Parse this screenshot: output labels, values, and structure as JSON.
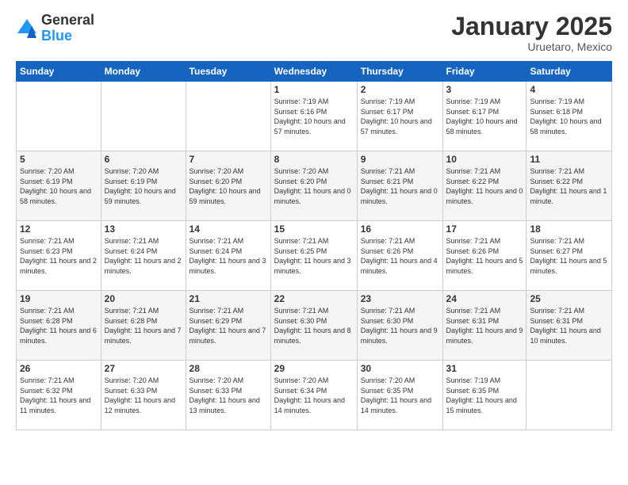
{
  "logo": {
    "general": "General",
    "blue": "Blue"
  },
  "header": {
    "month": "January 2025",
    "location": "Uruetaro, Mexico"
  },
  "weekdays": [
    "Sunday",
    "Monday",
    "Tuesday",
    "Wednesday",
    "Thursday",
    "Friday",
    "Saturday"
  ],
  "weeks": [
    [
      {
        "day": "",
        "info": ""
      },
      {
        "day": "",
        "info": ""
      },
      {
        "day": "",
        "info": ""
      },
      {
        "day": "1",
        "info": "Sunrise: 7:19 AM\nSunset: 6:16 PM\nDaylight: 10 hours and 57 minutes."
      },
      {
        "day": "2",
        "info": "Sunrise: 7:19 AM\nSunset: 6:17 PM\nDaylight: 10 hours and 57 minutes."
      },
      {
        "day": "3",
        "info": "Sunrise: 7:19 AM\nSunset: 6:17 PM\nDaylight: 10 hours and 58 minutes."
      },
      {
        "day": "4",
        "info": "Sunrise: 7:19 AM\nSunset: 6:18 PM\nDaylight: 10 hours and 58 minutes."
      }
    ],
    [
      {
        "day": "5",
        "info": "Sunrise: 7:20 AM\nSunset: 6:19 PM\nDaylight: 10 hours and 58 minutes."
      },
      {
        "day": "6",
        "info": "Sunrise: 7:20 AM\nSunset: 6:19 PM\nDaylight: 10 hours and 59 minutes."
      },
      {
        "day": "7",
        "info": "Sunrise: 7:20 AM\nSunset: 6:20 PM\nDaylight: 10 hours and 59 minutes."
      },
      {
        "day": "8",
        "info": "Sunrise: 7:20 AM\nSunset: 6:20 PM\nDaylight: 11 hours and 0 minutes."
      },
      {
        "day": "9",
        "info": "Sunrise: 7:21 AM\nSunset: 6:21 PM\nDaylight: 11 hours and 0 minutes."
      },
      {
        "day": "10",
        "info": "Sunrise: 7:21 AM\nSunset: 6:22 PM\nDaylight: 11 hours and 0 minutes."
      },
      {
        "day": "11",
        "info": "Sunrise: 7:21 AM\nSunset: 6:22 PM\nDaylight: 11 hours and 1 minute."
      }
    ],
    [
      {
        "day": "12",
        "info": "Sunrise: 7:21 AM\nSunset: 6:23 PM\nDaylight: 11 hours and 2 minutes."
      },
      {
        "day": "13",
        "info": "Sunrise: 7:21 AM\nSunset: 6:24 PM\nDaylight: 11 hours and 2 minutes."
      },
      {
        "day": "14",
        "info": "Sunrise: 7:21 AM\nSunset: 6:24 PM\nDaylight: 11 hours and 3 minutes."
      },
      {
        "day": "15",
        "info": "Sunrise: 7:21 AM\nSunset: 6:25 PM\nDaylight: 11 hours and 3 minutes."
      },
      {
        "day": "16",
        "info": "Sunrise: 7:21 AM\nSunset: 6:26 PM\nDaylight: 11 hours and 4 minutes."
      },
      {
        "day": "17",
        "info": "Sunrise: 7:21 AM\nSunset: 6:26 PM\nDaylight: 11 hours and 5 minutes."
      },
      {
        "day": "18",
        "info": "Sunrise: 7:21 AM\nSunset: 6:27 PM\nDaylight: 11 hours and 5 minutes."
      }
    ],
    [
      {
        "day": "19",
        "info": "Sunrise: 7:21 AM\nSunset: 6:28 PM\nDaylight: 11 hours and 6 minutes."
      },
      {
        "day": "20",
        "info": "Sunrise: 7:21 AM\nSunset: 6:28 PM\nDaylight: 11 hours and 7 minutes."
      },
      {
        "day": "21",
        "info": "Sunrise: 7:21 AM\nSunset: 6:29 PM\nDaylight: 11 hours and 7 minutes."
      },
      {
        "day": "22",
        "info": "Sunrise: 7:21 AM\nSunset: 6:30 PM\nDaylight: 11 hours and 8 minutes."
      },
      {
        "day": "23",
        "info": "Sunrise: 7:21 AM\nSunset: 6:30 PM\nDaylight: 11 hours and 9 minutes."
      },
      {
        "day": "24",
        "info": "Sunrise: 7:21 AM\nSunset: 6:31 PM\nDaylight: 11 hours and 9 minutes."
      },
      {
        "day": "25",
        "info": "Sunrise: 7:21 AM\nSunset: 6:31 PM\nDaylight: 11 hours and 10 minutes."
      }
    ],
    [
      {
        "day": "26",
        "info": "Sunrise: 7:21 AM\nSunset: 6:32 PM\nDaylight: 11 hours and 11 minutes."
      },
      {
        "day": "27",
        "info": "Sunrise: 7:20 AM\nSunset: 6:33 PM\nDaylight: 11 hours and 12 minutes."
      },
      {
        "day": "28",
        "info": "Sunrise: 7:20 AM\nSunset: 6:33 PM\nDaylight: 11 hours and 13 minutes."
      },
      {
        "day": "29",
        "info": "Sunrise: 7:20 AM\nSunset: 6:34 PM\nDaylight: 11 hours and 14 minutes."
      },
      {
        "day": "30",
        "info": "Sunrise: 7:20 AM\nSunset: 6:35 PM\nDaylight: 11 hours and 14 minutes."
      },
      {
        "day": "31",
        "info": "Sunrise: 7:19 AM\nSunset: 6:35 PM\nDaylight: 11 hours and 15 minutes."
      },
      {
        "day": "",
        "info": ""
      }
    ]
  ]
}
